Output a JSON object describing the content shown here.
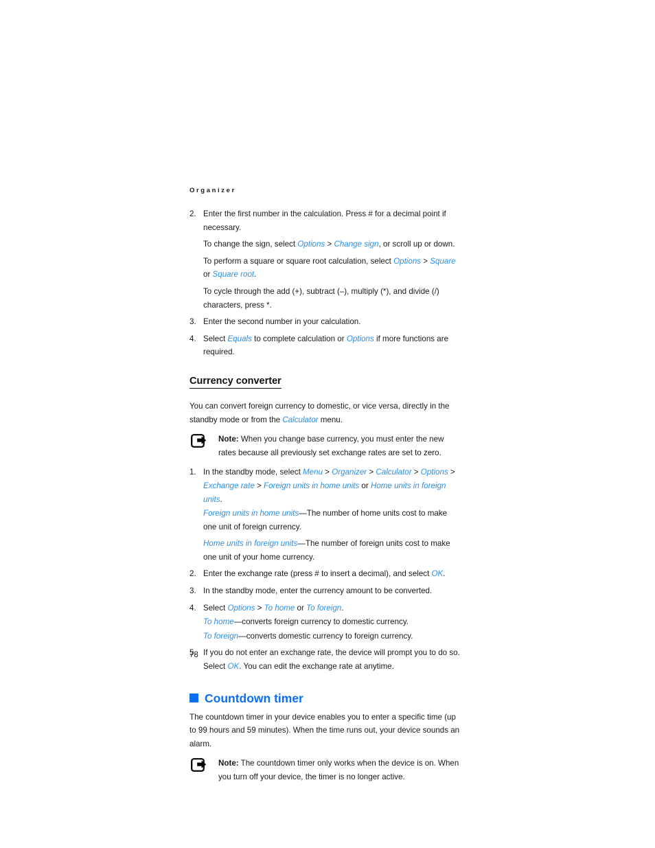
{
  "document": {
    "running_head": "Organizer",
    "page_number": "78",
    "colors": {
      "heading_blue": "#0c6ef0",
      "link_blue": "#2b8fe8",
      "body_text": "#1a1a1a"
    }
  },
  "calculator_steps": {
    "step2": {
      "num": "2.",
      "text_a": "Enter the first number in the calculation. Press # for a decimal point if necessary.",
      "sub1_a": "To change the sign, select ",
      "sub1_ui1": "Options",
      "sub1_sep1": " > ",
      "sub1_ui2": "Change sign",
      "sub1_b": ", or scroll up or down.",
      "sub2_a": "To perform a square or square root calculation, select ",
      "sub2_ui1": "Options",
      "sub2_sep1": " > ",
      "sub2_ui2": "Square",
      "sub2_b": " or ",
      "sub2_ui3": "Square root",
      "sub2_c": ".",
      "sub3_a": "To cycle through the add (+), subtract (–), multiply (*), and divide (/) characters, press *."
    },
    "step3": {
      "num": "3.",
      "text_a": "Enter the second number in your calculation."
    },
    "step4": {
      "num": "4.",
      "text_a": "Select ",
      "ui1": "Equals",
      "text_b": " to complete calculation or ",
      "ui2": "Options",
      "text_c": " if more functions are required."
    }
  },
  "currency_converter": {
    "heading": "Currency converter",
    "intro_a": "You can convert foreign currency to domestic, or vice versa, directly in the standby mode or from the ",
    "intro_ui": "Calculator",
    "intro_b": " menu.",
    "note": {
      "icon": "note-pointer-icon",
      "label": "Note:",
      "text": " When you change base currency, you must enter the new rates because all previously set exchange rates are set to zero."
    },
    "step1": {
      "num": "1.",
      "text_a": "In the standby mode, select ",
      "ui1": "Menu",
      "sep1": " > ",
      "ui2": "Organizer",
      "sep2": " > ",
      "ui3": "Calculator",
      "sep3": " > ",
      "ui4": "Options",
      "sep4": " > ",
      "ui5": "Exchange rate",
      "sep5": " > ",
      "ui6": "Foreign units in home units",
      "text_b": " or ",
      "ui7": "Home units in foreign units",
      "text_c": ".",
      "sub1_ui": "Foreign units in home units",
      "sub1_text": "—The number of home units cost to make one unit of foreign currency.",
      "sub2_ui": "Home units in foreign units",
      "sub2_text": "—The number of foreign units cost to make one unit of your home currency."
    },
    "step2": {
      "num": "2.",
      "text_a": "Enter the exchange rate (press # to insert a decimal), and select ",
      "ui1": "OK",
      "text_b": "."
    },
    "step3": {
      "num": "3.",
      "text_a": "In the standby mode, enter the currency amount to be converted."
    },
    "step4": {
      "num": "4.",
      "text_a": "Select ",
      "ui1": "Options",
      "sep1": " > ",
      "ui2": "To home",
      "text_b": " or ",
      "ui3": "To foreign",
      "text_c": ".",
      "sub1_ui": "To home",
      "sub1_text": "—converts foreign currency to domestic currency.",
      "sub2_ui": "To foreign",
      "sub2_text": "—converts domestic currency to foreign currency."
    },
    "step5": {
      "num": "5.",
      "text_a": "If you do not enter an exchange rate, the device will prompt you to do so. Select ",
      "ui1": "OK",
      "text_b": ". You can edit the exchange rate at anytime."
    }
  },
  "countdown_timer": {
    "heading": "Countdown timer",
    "bullet": "blue-square-bullet",
    "intro": "The countdown timer in your device enables you to enter a specific time (up to 99 hours and 59 minutes). When the time runs out, your device sounds an alarm.",
    "note": {
      "icon": "note-pointer-icon",
      "label": "Note:",
      "text": " The countdown timer only works when the device is on. When you turn off your device, the timer is no longer active."
    }
  }
}
